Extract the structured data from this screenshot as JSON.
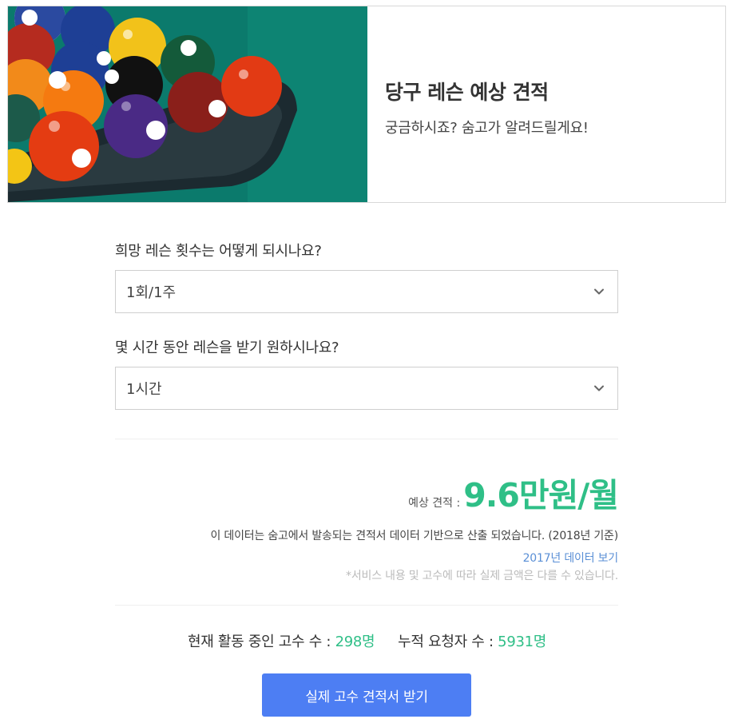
{
  "hero": {
    "title": "당구 레슨 예상 견적",
    "subtitle": "궁금하시죠? 숨고가 알려드릴게요!",
    "image_icon": "billiard-balls-image"
  },
  "form": {
    "question1": "희망 레슨 횟수는 어떻게 되시나요?",
    "select1_value": "1회/1주",
    "question2": "몇 시간 동안 레슨을 받기 원하시나요?",
    "select2_value": "1시간"
  },
  "estimate": {
    "label": "예상 견적 :",
    "value": "9.6만원/월"
  },
  "info": {
    "source": "이 데이터는 숨고에서 발송되는 견적서 데이터 기반으로 산출 되었습니다. (2018년 기준)",
    "link": "2017년 데이터 보기",
    "note": "*서비스 내용 및 고수에 따라 실제 금액은 다를 수 있습니다."
  },
  "stats": {
    "pros_label": "현재 활동 중인 고수 수 :",
    "pros_count": "298명",
    "requests_label": "누적 요청자 수 :",
    "requests_count": "5931명"
  },
  "cta": {
    "label": "실제 고수 견적서 받기"
  },
  "colors": {
    "accent_green": "#2fbf87",
    "button_blue": "#4d7ef3",
    "link_blue": "#5a8fd6",
    "table_felt": "#0b7a6c"
  }
}
